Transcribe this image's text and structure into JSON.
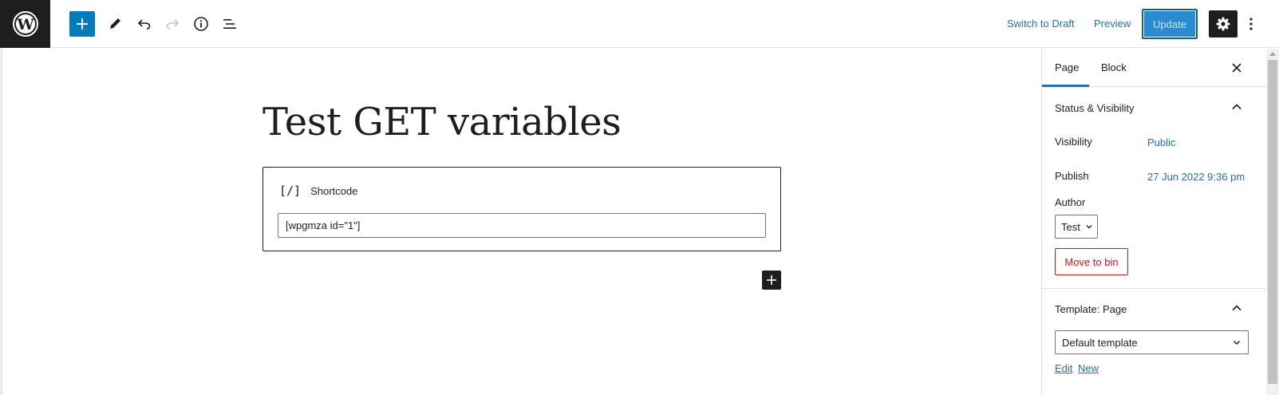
{
  "toolbar": {
    "switch_to_draft": "Switch to Draft",
    "preview": "Preview",
    "update": "Update"
  },
  "editor": {
    "post_title": "Test GET variables",
    "shortcode_block": {
      "icon_text": "[/]",
      "label": "Shortcode",
      "value": "[wpgmza id=\"1\"]"
    }
  },
  "sidebar": {
    "tabs": [
      {
        "label": "Page",
        "active": true
      },
      {
        "label": "Block",
        "active": false
      }
    ],
    "status_visibility": {
      "title": "Status & Visibility",
      "visibility_label": "Visibility",
      "visibility_value": "Public",
      "publish_label": "Publish",
      "publish_value": "27 Jun 2022 9:36 pm",
      "author_label": "Author",
      "author_value": "Test",
      "move_to_bin": "Move to bin"
    },
    "template": {
      "title": "Template: Page",
      "selected": "Default template",
      "edit_link": "Edit",
      "new_link": "New"
    }
  },
  "colors": {
    "accent": "#007cba",
    "link": "#2271b1",
    "danger": "#cc1818",
    "dark": "#1e1e1e"
  }
}
